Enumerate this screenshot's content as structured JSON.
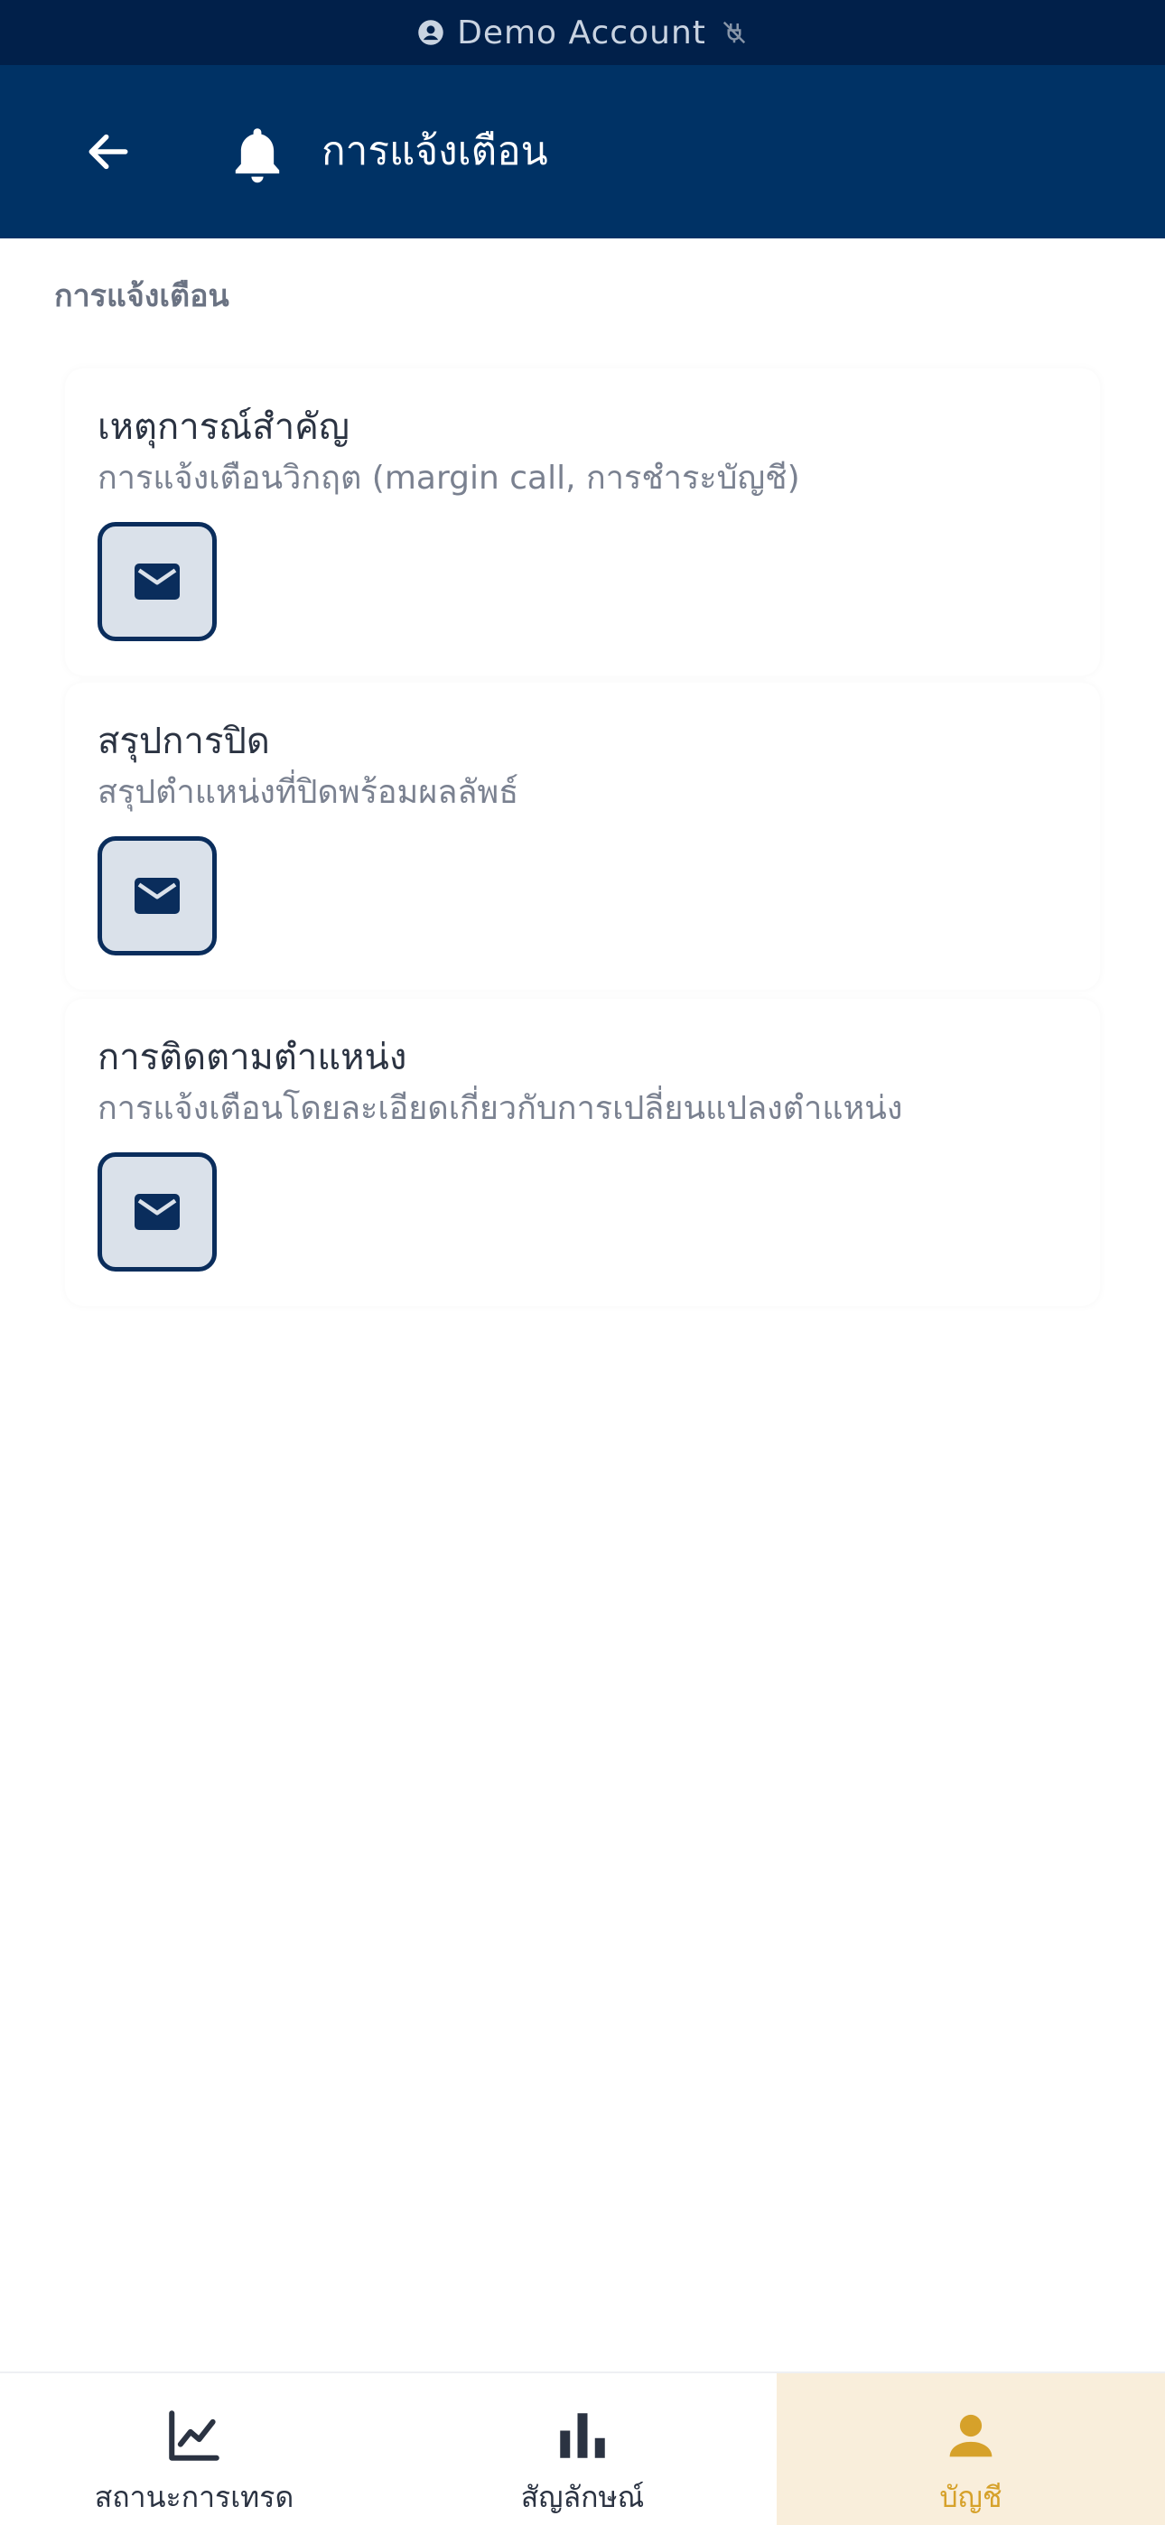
{
  "demo_bar": {
    "label": "Demo Account",
    "account_icon": "account-circle-icon",
    "status_icon": "link-off-icon"
  },
  "header": {
    "back_icon": "arrow-left-icon",
    "bell_icon": "bell-icon",
    "title": "การแจ้งเตือน"
  },
  "section": {
    "label": "การแจ้งเตือน"
  },
  "notifications": [
    {
      "title": "เหตุการณ์สำคัญ",
      "description": "การแจ้งเตือนวิกฤต (margin call, การชำระบัญชี)",
      "channel_icon": "mail-icon"
    },
    {
      "title": "สรุปการปิด",
      "description": "สรุปตำแหน่งที่ปิดพร้อมผลลัพธ์",
      "channel_icon": "mail-icon"
    },
    {
      "title": "การติดตามตำแหน่ง",
      "description": "การแจ้งเตือนโดยละเอียดเกี่ยวกับการเปลี่ยนแปลงตำแหน่ง",
      "channel_icon": "mail-icon"
    }
  ],
  "bottom_nav": {
    "items": [
      {
        "label": "สถานะการเทรด",
        "icon": "chart-line-icon",
        "active": false
      },
      {
        "label": "สัญลักษณ์",
        "icon": "bar-chart-icon",
        "active": false
      },
      {
        "label": "บัญชี",
        "icon": "person-icon",
        "active": true
      }
    ]
  },
  "colors": {
    "demo_bar": "#01204a",
    "header": "#003265",
    "accent": "#d6a12a",
    "active_tab_bg": "#f9eedb",
    "mail_button_bg": "#dae1ea",
    "mail_button_border": "#0a2d5c"
  }
}
